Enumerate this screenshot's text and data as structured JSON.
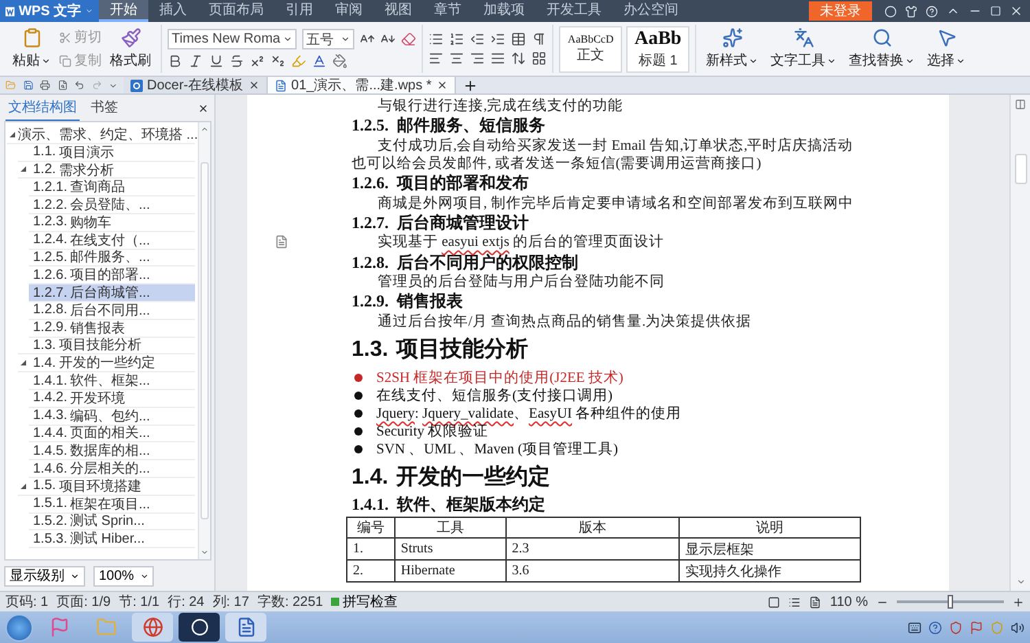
{
  "app_menu": {
    "label": "WPS 文字"
  },
  "menu_tabs": [
    {
      "label": "开始",
      "selected": true
    },
    {
      "label": "插入",
      "selected": false
    },
    {
      "label": "页面布局",
      "selected": false
    },
    {
      "label": "引用",
      "selected": false
    },
    {
      "label": "审阅",
      "selected": false
    },
    {
      "label": "视图",
      "selected": false
    },
    {
      "label": "章节",
      "selected": false
    },
    {
      "label": "加载项",
      "selected": false
    },
    {
      "label": "开发工具",
      "selected": false
    },
    {
      "label": "办公空间",
      "selected": false
    }
  ],
  "login_button": {
    "label": "未登录"
  },
  "ribbon": {
    "clipboard": {
      "paste": "粘贴",
      "cut": "剪切",
      "copy": "复制",
      "format_painter": "格式刷"
    },
    "font": {
      "name": "Times New Roma",
      "size": "五号"
    },
    "styles": [
      {
        "preview": "AaBbCcD",
        "label": "正文",
        "kind": "body"
      },
      {
        "preview": "AaBb",
        "label": "标题 1",
        "kind": "heading"
      }
    ],
    "tools": [
      {
        "label": "新样式",
        "kind": "style"
      },
      {
        "label": "文字工具",
        "kind": "text"
      },
      {
        "label": "查找替换",
        "kind": "find"
      },
      {
        "label": "选择",
        "kind": "select"
      }
    ]
  },
  "doc_tabs": [
    {
      "label": "Docer-在线模板",
      "kind": "docer",
      "selected": false
    },
    {
      "label": "01_演示、需...建.wps *",
      "kind": "document",
      "selected": true
    }
  ],
  "nav": {
    "tabs": [
      {
        "label": "文档结构图",
        "selected": true
      },
      {
        "label": "书签",
        "selected": false
      }
    ],
    "tree": [
      {
        "text": "演示、需求、约定、环境搭 ...",
        "expanded": true,
        "selected": false,
        "children": [
          {
            "num": "1.1.",
            "text": "项目演示",
            "selected": false
          },
          {
            "num": "1.2.",
            "text": "需求分析",
            "expanded": true,
            "selected": false,
            "children": [
              {
                "num": "1.2.1.",
                "text": "查询商品",
                "selected": false
              },
              {
                "num": "1.2.2.",
                "text": "会员登陆、...",
                "selected": false
              },
              {
                "num": "1.2.3.",
                "text": "购物车",
                "selected": false
              },
              {
                "num": "1.2.4.",
                "text": "在线支付（...",
                "selected": false
              },
              {
                "num": "1.2.5.",
                "text": "邮件服务、...",
                "selected": false
              },
              {
                "num": "1.2.6.",
                "text": "项目的部署...",
                "selected": false
              },
              {
                "num": "1.2.7.",
                "text": "后台商城管...",
                "selected": true
              },
              {
                "num": "1.2.8.",
                "text": "后台不同用...",
                "selected": false
              },
              {
                "num": "1.2.9.",
                "text": "销售报表",
                "selected": false
              }
            ]
          },
          {
            "num": "1.3.",
            "text": "项目技能分析",
            "selected": false
          },
          {
            "num": "1.4.",
            "text": "开发的一些约定",
            "expanded": true,
            "selected": false,
            "children": [
              {
                "num": "1.4.1.",
                "text": "软件、框架...",
                "selected": false
              },
              {
                "num": "1.4.2.",
                "text": "开发环境",
                "selected": false
              },
              {
                "num": "1.4.3.",
                "text": "编码、包约...",
                "selected": false
              },
              {
                "num": "1.4.4.",
                "text": "页面的相关...",
                "selected": false
              },
              {
                "num": "1.4.5.",
                "text": "数据库的相...",
                "selected": false
              },
              {
                "num": "1.4.6.",
                "text": "分层相关的...",
                "selected": false
              }
            ]
          },
          {
            "num": "1.5.",
            "text": "项目环境搭建",
            "expanded": true,
            "selected": false,
            "children": [
              {
                "num": "1.5.1.",
                "text": "框架在项目...",
                "selected": false
              },
              {
                "num": "1.5.2.",
                "text": "测试 Sprin...",
                "selected": false
              },
              {
                "num": "1.5.3.",
                "text": "测试 Hiber...",
                "selected": false
              }
            ]
          }
        ]
      }
    ],
    "level_select": "显示级别",
    "zoom_select": "100%"
  },
  "document": [
    {
      "kind": "para",
      "runs": [
        {
          "text": "与银行进行连接,完成在线支付的功能",
          "misspelled": false
        }
      ]
    },
    {
      "kind": "heading3",
      "num": "1.2.5.",
      "text": "邮件服务、短信服务"
    },
    {
      "kind": "para",
      "runs": [
        {
          "text": "支付成功后,会自动给买家发送一封 Email 告知,订单状态,平时店庆搞活动也可以给会员发邮件, 或者发送一条短信(需要调用运营商接口)",
          "misspelled": false
        }
      ]
    },
    {
      "kind": "heading3",
      "num": "1.2.6.",
      "text": "项目的部署和发布"
    },
    {
      "kind": "para",
      "runs": [
        {
          "text": "商城是外网项目, 制作完毕后肯定要申请域名和空间部署发布到互联网中",
          "misspelled": false
        }
      ]
    },
    {
      "kind": "heading3",
      "num": "1.2.7.",
      "text": "后台商城管理设计"
    },
    {
      "kind": "para",
      "margin_icon": true,
      "runs": [
        {
          "text": "实现基于 ",
          "misspelled": false
        },
        {
          "text": "easyui extjs",
          "misspelled": true
        },
        {
          "text": " 的后台的管理页面设计",
          "misspelled": false
        }
      ]
    },
    {
      "kind": "heading3",
      "num": "1.2.8.",
      "text": "后台不同用户的权限控制"
    },
    {
      "kind": "para",
      "runs": [
        {
          "text": "管理员的后台登陆与用户后台登陆功能不同",
          "misspelled": false
        }
      ]
    },
    {
      "kind": "heading3",
      "num": "1.2.9.",
      "text": "销售报表"
    },
    {
      "kind": "para",
      "runs": [
        {
          "text": "通过后台按年/月  查询热点商品的销售量.为决策提供依据",
          "misspelled": false
        }
      ]
    },
    {
      "kind": "heading2",
      "num": "1.3.",
      "text": "项目技能分析"
    },
    {
      "kind": "bullet",
      "color": "#c62828",
      "runs": [
        {
          "text": "S2SH 框架在项目中的使用(J2EE 技术)",
          "misspelled": false
        }
      ]
    },
    {
      "kind": "bullet",
      "color": "#111111",
      "runs": [
        {
          "text": "在线支付、短信服务(支付接口调用)",
          "misspelled": false
        }
      ]
    },
    {
      "kind": "bullet",
      "color": "#111111",
      "runs": [
        {
          "text": "Jquery",
          "misspelled": true
        },
        {
          "text": ": ",
          "misspelled": false
        },
        {
          "text": "Jquery_validate",
          "misspelled": true
        },
        {
          "text": "、",
          "misspelled": false
        },
        {
          "text": "EasyUI",
          "misspelled": true
        },
        {
          "text": " 各种组件的使用",
          "misspelled": false
        }
      ]
    },
    {
      "kind": "bullet",
      "color": "#111111",
      "runs": [
        {
          "text": "Security 权限验证",
          "misspelled": false
        }
      ]
    },
    {
      "kind": "bullet",
      "color": "#111111",
      "runs": [
        {
          "text": "SVN 、UML 、Maven (项目管理工具)",
          "misspelled": false
        }
      ]
    },
    {
      "kind": "heading2",
      "num": "1.4.",
      "text": "开发的一些约定"
    },
    {
      "kind": "heading3",
      "num": "1.4.1.",
      "text": "软件、框架版本约定"
    },
    {
      "kind": "table",
      "columns": [
        "编号",
        "工具",
        "版本",
        "说明"
      ],
      "rows": [
        [
          "1.",
          "Struts",
          "2.3",
          "显示层框架"
        ],
        [
          "2.",
          "Hibernate",
          "3.6",
          "实现持久化操作"
        ]
      ]
    }
  ],
  "status_bar": {
    "fields": [
      "页码: 1",
      "页面: 1/9",
      "节: 1/1",
      "行: 24",
      "列: 17",
      "字数: 2251"
    ],
    "spell_check": {
      "label": "拼写检查",
      "on": true
    },
    "zoom": {
      "reading": "110 %",
      "level": 0.5
    }
  }
}
